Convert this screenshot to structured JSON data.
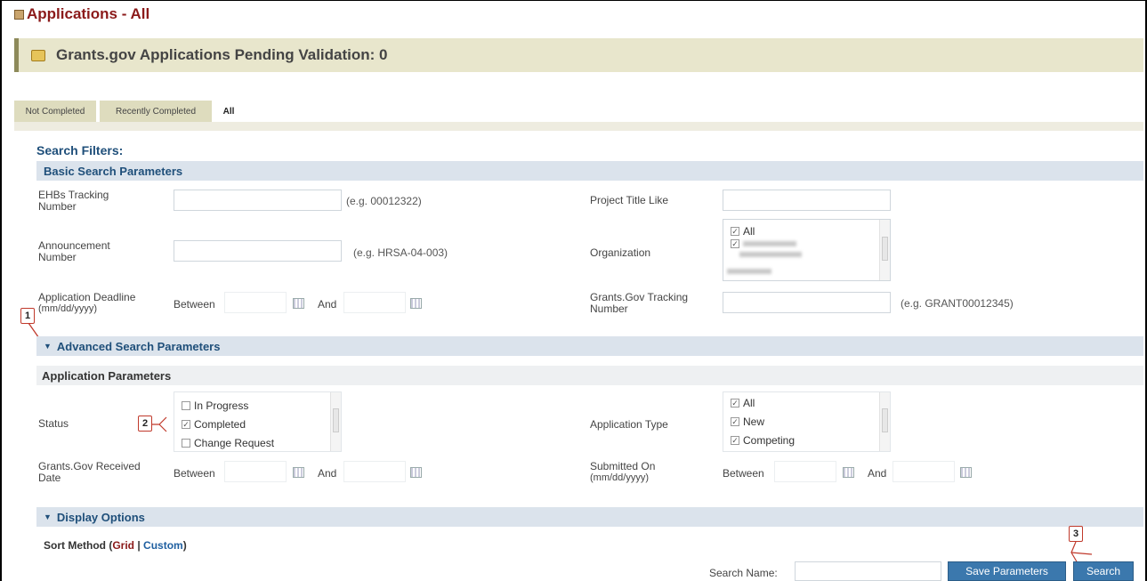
{
  "page": {
    "title": "Applications - All"
  },
  "pending": {
    "text": "Grants.gov Applications Pending Validation: 0"
  },
  "tabs": [
    {
      "label": "Not Completed"
    },
    {
      "label": "Recently Completed"
    },
    {
      "label": "All"
    }
  ],
  "search_filters_label": "Search Filters:",
  "basic": {
    "heading": "Basic Search Parameters",
    "tracking_number": {
      "label_line1": "EHBs Tracking",
      "label_line2": "Number",
      "value": "",
      "hint": "(e.g. 00012322)"
    },
    "announcement_number": {
      "label_line1": "Announcement",
      "label_line2": "Number",
      "value": "",
      "hint": "(e.g. HRSA-04-003)"
    },
    "deadline": {
      "label_line1": "Application Deadline",
      "label_line2": "(mm/dd/yyyy)",
      "between": "Between",
      "and": "And"
    },
    "project_title": {
      "label": "Project Title Like",
      "value": ""
    },
    "organization": {
      "label": "Organization",
      "options": [
        "All"
      ]
    },
    "grants_tracking": {
      "label_line1": "Grants.Gov Tracking",
      "label_line2": "Number",
      "value": "",
      "hint": "(e.g. GRANT00012345)"
    }
  },
  "advanced": {
    "heading": "Advanced Search Parameters"
  },
  "application_params": {
    "heading": "Application Parameters",
    "status": {
      "label": "Status",
      "options": [
        "In Progress",
        "Completed",
        "Change Request"
      ]
    },
    "received_date": {
      "label_line1": "Grants.Gov Received",
      "label_line2": "Date",
      "between": "Between",
      "and": "And"
    },
    "application_type": {
      "label": "Application Type",
      "options": [
        "All",
        "New",
        "Competing"
      ]
    },
    "submitted_on": {
      "label_line1": "Submitted On",
      "label_line2": "(mm/dd/yyyy)",
      "between": "Between",
      "and": "And"
    }
  },
  "display_options": {
    "heading": "Display Options"
  },
  "sort": {
    "prefix": "Sort Method (",
    "grid": "Grid",
    "separator": " | ",
    "custom": "Custom",
    "suffix": ")"
  },
  "footer": {
    "search_name_label": "Search Name:",
    "search_name_value": "",
    "save_button": "Save Parameters",
    "search_button": "Search"
  },
  "markers": [
    "1",
    "2",
    "3"
  ],
  "colors": {
    "title": "#8b1a1a",
    "section_text": "#1f4f7a",
    "button": "#3b78ad",
    "marker_border": "#c0392b"
  }
}
